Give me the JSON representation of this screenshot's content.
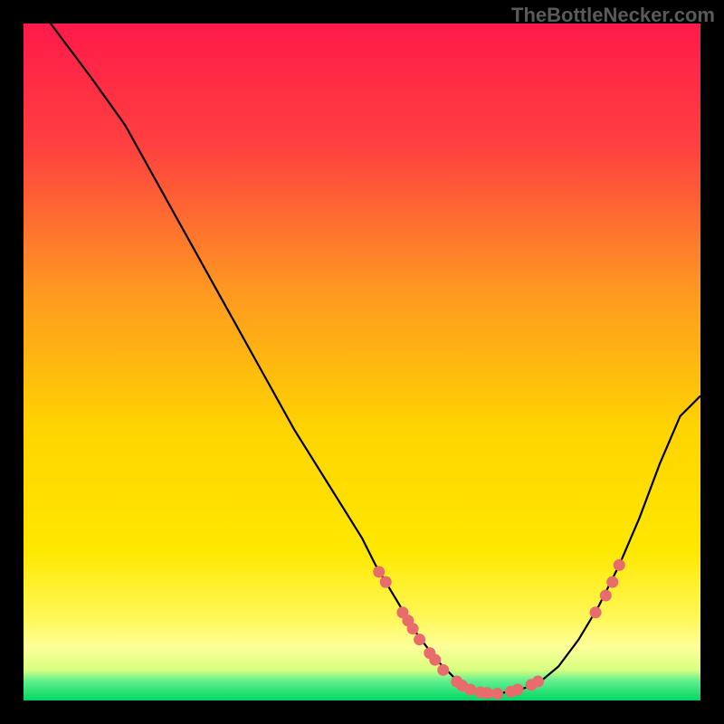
{
  "watermark": "TheBottleNecker.com",
  "chart_data": {
    "type": "line",
    "title": "",
    "xlabel": "",
    "ylabel": "",
    "xlim": [
      0,
      100
    ],
    "ylim": [
      0,
      100
    ],
    "background_gradient": {
      "top": "#ff1a4a",
      "mid": "#ffd400",
      "band_yellow": "#ffff66",
      "bottom_green": "#00e676"
    },
    "curve": [
      {
        "x": 4,
        "y": 100
      },
      {
        "x": 10,
        "y": 92
      },
      {
        "x": 15,
        "y": 85
      },
      {
        "x": 20,
        "y": 76
      },
      {
        "x": 25,
        "y": 67
      },
      {
        "x": 30,
        "y": 58
      },
      {
        "x": 35,
        "y": 49
      },
      {
        "x": 40,
        "y": 40
      },
      {
        "x": 45,
        "y": 32
      },
      {
        "x": 50,
        "y": 24
      },
      {
        "x": 52,
        "y": 20
      },
      {
        "x": 55,
        "y": 15
      },
      {
        "x": 58,
        "y": 10
      },
      {
        "x": 61,
        "y": 6
      },
      {
        "x": 64,
        "y": 3
      },
      {
        "x": 67,
        "y": 1.5
      },
      {
        "x": 70,
        "y": 1
      },
      {
        "x": 73,
        "y": 1.5
      },
      {
        "x": 76,
        "y": 2.5
      },
      {
        "x": 79,
        "y": 5
      },
      {
        "x": 82,
        "y": 9
      },
      {
        "x": 85,
        "y": 14
      },
      {
        "x": 88,
        "y": 20
      },
      {
        "x": 91,
        "y": 27
      },
      {
        "x": 94,
        "y": 35
      },
      {
        "x": 97,
        "y": 42
      },
      {
        "x": 100,
        "y": 45
      }
    ],
    "markers": [
      {
        "x": 52.5,
        "y": 19
      },
      {
        "x": 53.5,
        "y": 17.5
      },
      {
        "x": 56,
        "y": 13
      },
      {
        "x": 56.8,
        "y": 11.8
      },
      {
        "x": 57.5,
        "y": 10.6
      },
      {
        "x": 58.5,
        "y": 9
      },
      {
        "x": 60,
        "y": 7
      },
      {
        "x": 60.8,
        "y": 6
      },
      {
        "x": 62,
        "y": 4.5
      },
      {
        "x": 64,
        "y": 2.8
      },
      {
        "x": 64.8,
        "y": 2.2
      },
      {
        "x": 66,
        "y": 1.6
      },
      {
        "x": 67.5,
        "y": 1.2
      },
      {
        "x": 68.5,
        "y": 1.1
      },
      {
        "x": 70,
        "y": 1
      },
      {
        "x": 72,
        "y": 1.3
      },
      {
        "x": 73,
        "y": 1.6
      },
      {
        "x": 75,
        "y": 2.3
      },
      {
        "x": 76,
        "y": 2.8
      },
      {
        "x": 84.5,
        "y": 13
      },
      {
        "x": 86,
        "y": 15.5
      },
      {
        "x": 87,
        "y": 17.5
      },
      {
        "x": 88,
        "y": 20
      }
    ],
    "marker_color": "#e86c6c"
  }
}
